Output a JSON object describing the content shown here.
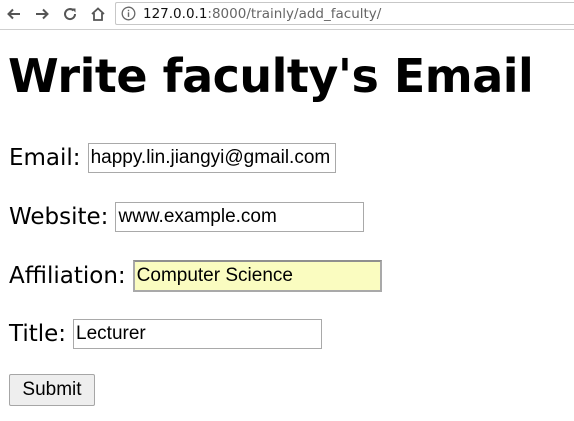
{
  "browser": {
    "url_host": "127.0.0.1",
    "url_path": ":8000/trainly/add_faculty/"
  },
  "page": {
    "heading": "Write faculty's Email"
  },
  "form": {
    "email": {
      "label": "Email:",
      "value": "happy.lin.jiangyi@gmail.com"
    },
    "website": {
      "label": "Website:",
      "value": "www.example.com"
    },
    "affiliation": {
      "label": "Affiliation:",
      "value": "Computer Science",
      "autofill_color": "#fafcc0"
    },
    "title": {
      "label": "Title:",
      "value": "Lecturer"
    },
    "submit_label": "Submit"
  },
  "icons": [
    "back-arrow-icon",
    "forward-arrow-icon",
    "reload-icon",
    "home-icon",
    "info-icon"
  ]
}
